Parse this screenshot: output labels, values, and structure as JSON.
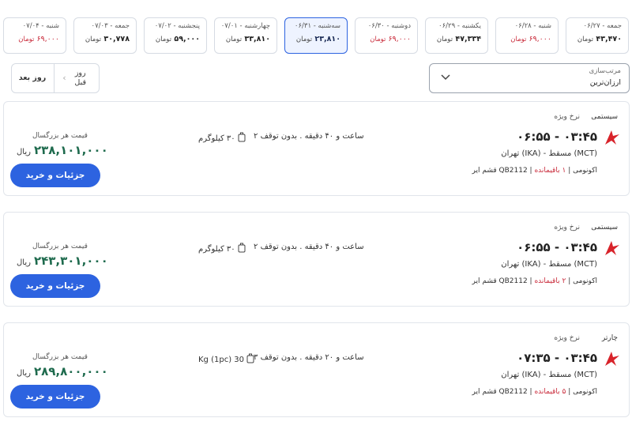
{
  "dates": [
    {
      "label": "جمعه - ۰۶/۲۷",
      "price": "۴۳,۴۷۰",
      "unit": "تومان",
      "low": false,
      "selected": false
    },
    {
      "label": "شنبه - ۰۶/۲۸",
      "price": "۶۹,۰۰۰",
      "unit": "تومان",
      "low": true,
      "selected": false
    },
    {
      "label": "یکشنبه - ۰۶/۲۹",
      "price": "۴۷,۳۳۴",
      "unit": "تومان",
      "low": false,
      "selected": false
    },
    {
      "label": "دوشنبه - ۰۶/۳۰",
      "price": "۶۹,۰۰۰",
      "unit": "تومان",
      "low": true,
      "selected": false
    },
    {
      "label": "سه‌شنبه - ۰۶/۳۱",
      "price": "۲۳,۸۱۰",
      "unit": "تومان",
      "low": false,
      "selected": true
    },
    {
      "label": "چهارشنبه - ۰۷/۰۱",
      "price": "۳۳,۸۱۰",
      "unit": "تومان",
      "low": false,
      "selected": false
    },
    {
      "label": "پنجشنبه - ۰۷/۰۲",
      "price": "۵۹,۰۰۰",
      "unit": "تومان",
      "low": false,
      "selected": false
    },
    {
      "label": "جمعه - ۰۷/۰۳",
      "price": "۳۰,۷۷۸",
      "unit": "تومان",
      "low": false,
      "selected": false
    },
    {
      "label": "شنبه - ۰۷/۰۴",
      "price": "۶۹,۰۰۰",
      "unit": "تومان",
      "low": true,
      "selected": false
    }
  ],
  "nav": {
    "prev_day": "روز قبل",
    "next_day": "روز بعد"
  },
  "sort": {
    "label": "مرتب‌سازی",
    "value": "ارزان‌ترین"
  },
  "flights": [
    {
      "type": "سیستمی",
      "fare": "نرخ ویژه",
      "times": "۰۶:۵۵ - ۰۳:۴۵",
      "route": "تهران (IKA) - مسقط (MCT)",
      "airline": "قشم ایر QB2112 | اکونومی |",
      "seats": "۱ باقیمانده",
      "duration": "۲ ساعت و ۴۰ دقیقه . بدون توقف",
      "baggage": "۳۰ کیلوگرم",
      "price_label": "قیمت هر بزرگسال",
      "price": "۲۳۸,۱۰۱,۰۰۰",
      "currency": "ریال",
      "buy": "جزئیات و خرید"
    },
    {
      "type": "سیستمی",
      "fare": "نرخ ویژه",
      "times": "۰۶:۵۵ - ۰۳:۴۵",
      "route": "تهران (IKA) - مسقط (MCT)",
      "airline": "قشم ایر QB2112 | اکونومی |",
      "seats": "۲ باقیمانده",
      "duration": "۲ ساعت و ۴۰ دقیقه . بدون توقف",
      "baggage": "۳۰ کیلوگرم",
      "price_label": "قیمت هر بزرگسال",
      "price": "۲۴۳,۳۰۱,۰۰۰",
      "currency": "ریال",
      "buy": "جزئیات و خرید"
    },
    {
      "type": "چارتر",
      "fare": "نرخ ویژه",
      "times": "۰۷:۳۵ - ۰۳:۴۵",
      "route": "تهران (IKA) - مسقط (MCT)",
      "airline": "قشم ایر QB2112 | اکونومی |",
      "seats": "۵ باقیمانده",
      "duration": "۳ ساعت و ۲۰ دقیقه . بدون توقف",
      "baggage": "30 Kg (1pc)",
      "price_label": "قیمت هر بزرگسال",
      "price": "۲۸۹,۸۰۰,۰۰۰",
      "currency": "ریال",
      "buy": "جزئیات و خرید"
    }
  ],
  "colors": {
    "accent": "#2d63e0",
    "price": "#1f6b4e",
    "alert": "#c92a3a",
    "logo": "#d8232a"
  }
}
